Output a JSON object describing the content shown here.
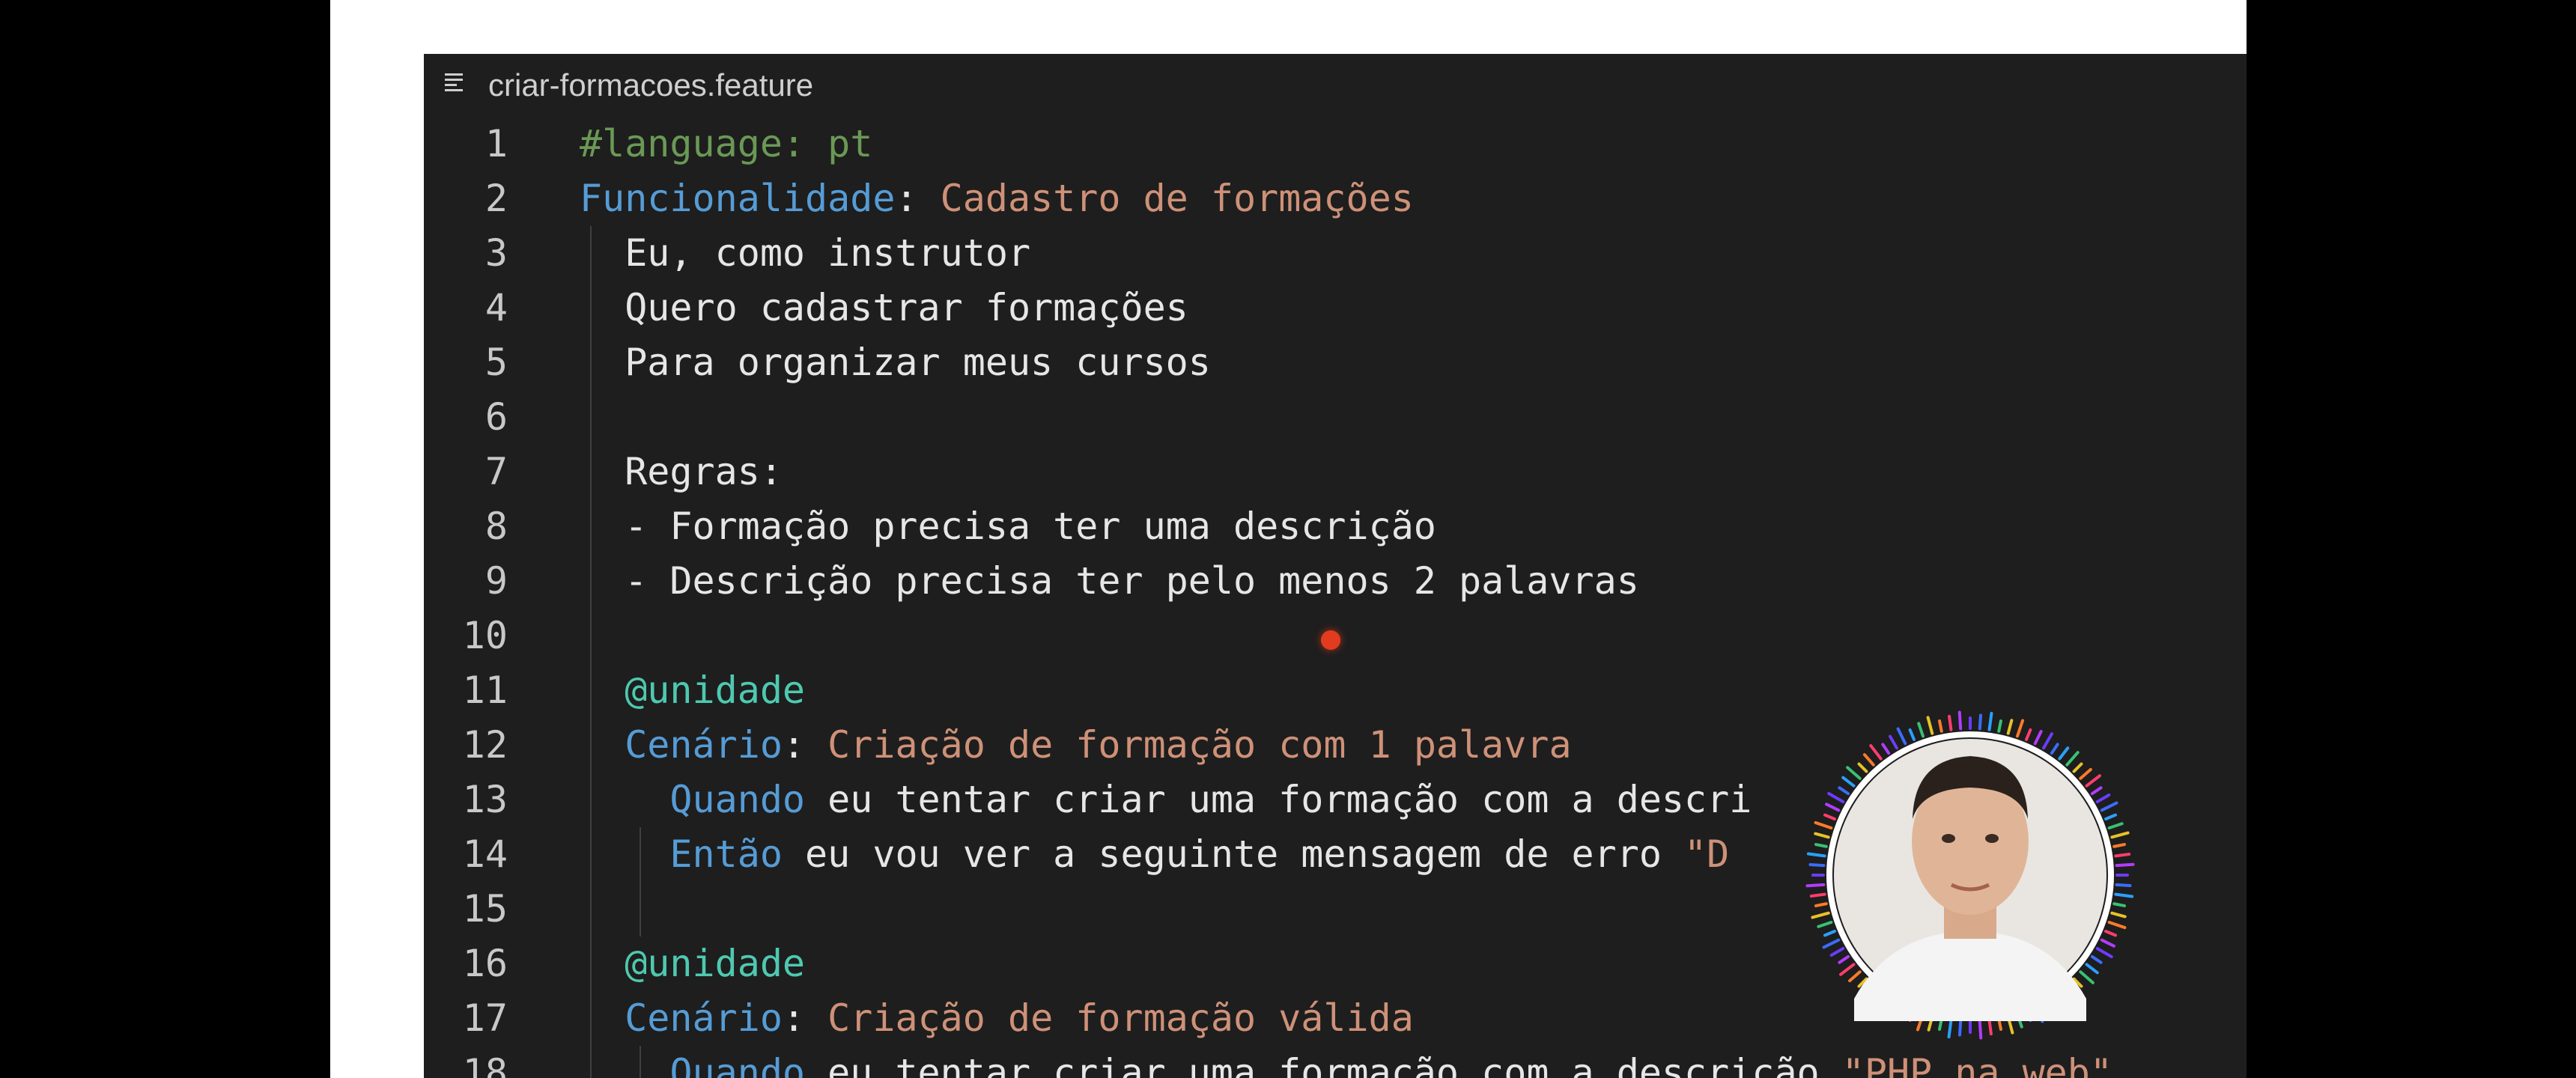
{
  "editor": {
    "file_name": "criar-formacoes.feature",
    "file_icon": "lines-icon"
  },
  "lines": [
    {
      "n": "1",
      "segments": [
        {
          "t": "#language: pt",
          "c": "c-comment"
        }
      ]
    },
    {
      "n": "2",
      "segments": [
        {
          "t": "Funcionalidade",
          "c": "c-keyword"
        },
        {
          "t": ": ",
          "c": "c-plain"
        },
        {
          "t": "Cadastro de formações",
          "c": "c-title"
        }
      ]
    },
    {
      "n": "3",
      "segments": [
        {
          "t": "  Eu, como instrutor",
          "c": "c-plain"
        }
      ]
    },
    {
      "n": "4",
      "segments": [
        {
          "t": "  Quero cadastrar formações",
          "c": "c-plain"
        }
      ]
    },
    {
      "n": "5",
      "segments": [
        {
          "t": "  Para organizar meus cursos",
          "c": "c-plain"
        }
      ]
    },
    {
      "n": "6",
      "segments": []
    },
    {
      "n": "7",
      "segments": [
        {
          "t": "  Regras:",
          "c": "c-plain"
        }
      ]
    },
    {
      "n": "8",
      "segments": [
        {
          "t": "  - Formação precisa ter uma descrição",
          "c": "c-plain"
        }
      ]
    },
    {
      "n": "9",
      "segments": [
        {
          "t": "  - Descrição precisa ter pelo menos 2 palavras",
          "c": "c-plain"
        }
      ]
    },
    {
      "n": "10",
      "segments": []
    },
    {
      "n": "11",
      "segments": [
        {
          "t": "  @unidade",
          "c": "c-tag"
        }
      ]
    },
    {
      "n": "12",
      "segments": [
        {
          "t": "  Cenário",
          "c": "c-keyword"
        },
        {
          "t": ": ",
          "c": "c-plain"
        },
        {
          "t": "Criação de formação com 1 palavra",
          "c": "c-title"
        }
      ]
    },
    {
      "n": "13",
      "segments": [
        {
          "t": "    Quando",
          "c": "c-keyword"
        },
        {
          "t": " eu tentar criar uma formação com a descri",
          "c": "c-plain"
        }
      ]
    },
    {
      "n": "14",
      "segments": [
        {
          "t": "    Então",
          "c": "c-keyword"
        },
        {
          "t": " eu vou ver a seguinte mensagem de erro ",
          "c": "c-plain"
        },
        {
          "t": "\"D      isa t",
          "c": "c-string"
        }
      ]
    },
    {
      "n": "15",
      "segments": []
    },
    {
      "n": "16",
      "segments": [
        {
          "t": "  @unidade",
          "c": "c-tag"
        }
      ]
    },
    {
      "n": "17",
      "segments": [
        {
          "t": "  Cenário",
          "c": "c-keyword"
        },
        {
          "t": ": ",
          "c": "c-plain"
        },
        {
          "t": "Criação de formação válida",
          "c": "c-title"
        }
      ]
    },
    {
      "n": "18",
      "segments": [
        {
          "t": "    Quando",
          "c": "c-keyword"
        },
        {
          "t": " eu tentar criar uma formação com a descrição ",
          "c": "c-plain"
        },
        {
          "t": "\"PHP na web\"",
          "c": "c-string"
        }
      ]
    }
  ],
  "overlay": {
    "avatar_icon": "presenter-avatar-icon",
    "cursor_icon": "mouse-pointer-dot-icon"
  },
  "colors": {
    "background": "#000000",
    "panel": "#ffffff",
    "editor": "#1e1e1e",
    "comment": "#6a9955",
    "keyword": "#569cd6",
    "text": "#e6e6e6",
    "title": "#ce9178",
    "tag": "#4ec9b0"
  }
}
